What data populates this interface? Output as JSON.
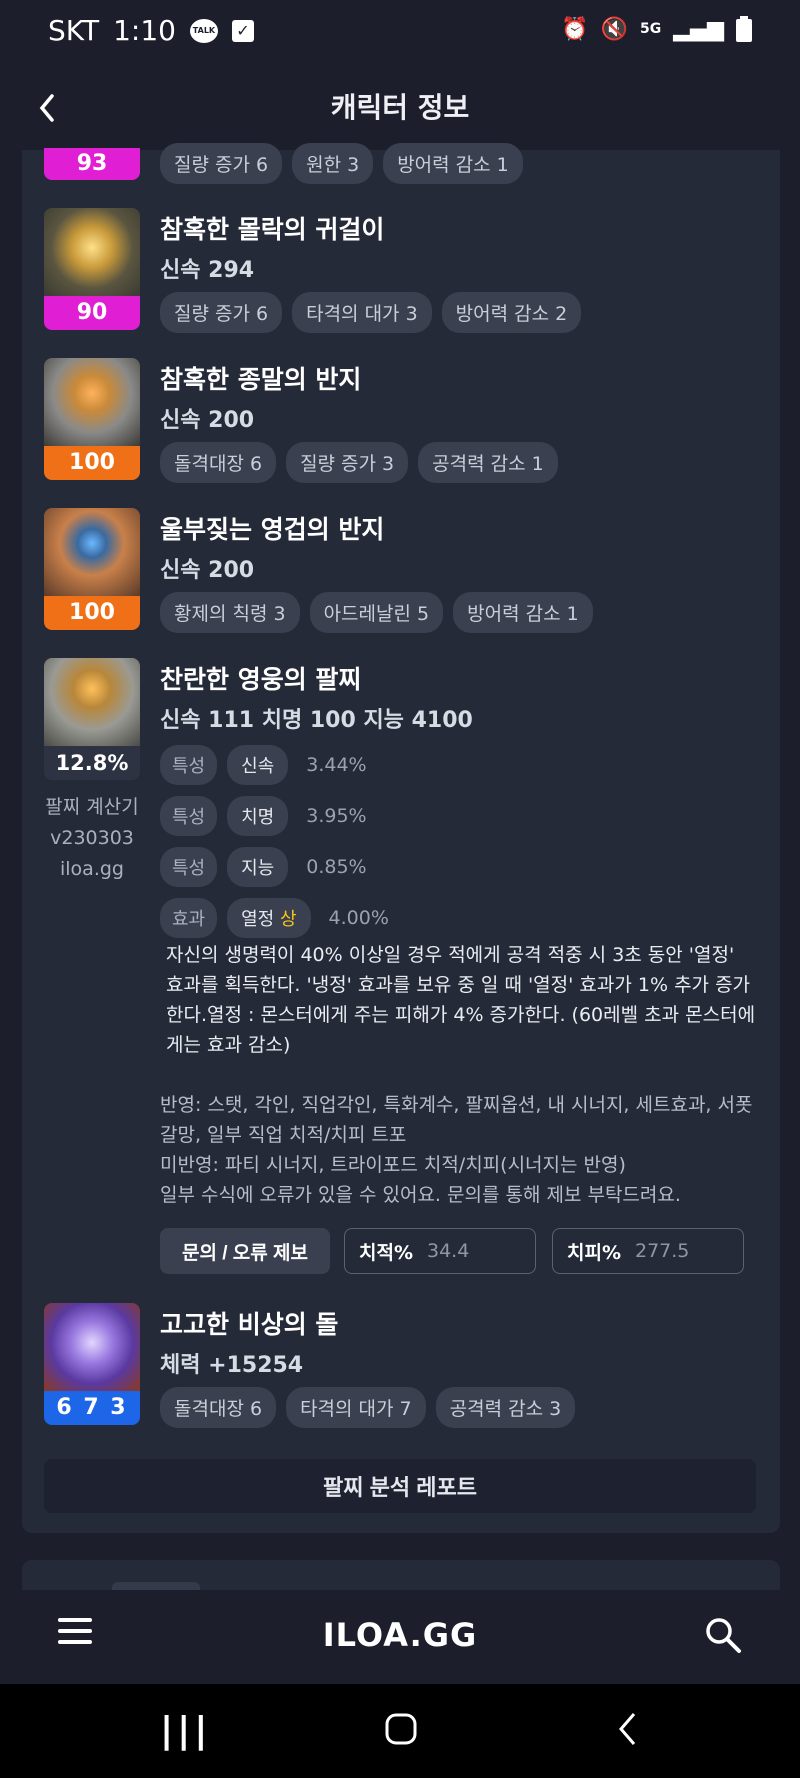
{
  "status": {
    "carrier": "SKT",
    "time": "1:10",
    "talk_badge": "TALK",
    "icons": [
      "alarm-icon",
      "mute-icon",
      "5g-icon",
      "signal-icon",
      "battery-icon"
    ]
  },
  "header": {
    "title": "캐릭터 정보"
  },
  "items": [
    {
      "level": "93",
      "level_color": "#e01fd4",
      "chips": [
        "질량 증가 6",
        "원한 3",
        "방어력 감소 1"
      ]
    },
    {
      "name": "참혹한 몰락의 귀걸이",
      "stat": "신속 294",
      "level": "90",
      "level_color": "#e01fd4",
      "chips": [
        "질량 증가 6",
        "타격의 대가 3",
        "방어력 감소 2"
      ]
    },
    {
      "name": "참혹한 종말의 반지",
      "stat": "신속 200",
      "level": "100",
      "level_color": "#f07018",
      "chips": [
        "돌격대장 6",
        "질량 증가 3",
        "공격력 감소 1"
      ]
    },
    {
      "name": "울부짖는 영겁의 반지",
      "stat": "신속 200",
      "level": "100",
      "level_color": "#f07018",
      "chips": [
        "황제의 칙령 3",
        "아드레날린 5",
        "방어력 감소 1"
      ]
    }
  ],
  "bracelet": {
    "name": "찬란한 영웅의 팔찌",
    "stat": "신속 111  치명 100  지능 4100",
    "percent": "12.8%",
    "calc_lines": [
      "팔찌 계산기",
      "v230303",
      "iloa.gg"
    ],
    "traits": [
      {
        "tag": "특성",
        "name": "신속",
        "pct": "3.44%"
      },
      {
        "tag": "특성",
        "name": "치명",
        "pct": "3.95%"
      },
      {
        "tag": "특성",
        "name": "지능",
        "pct": "0.85%"
      }
    ],
    "effect": {
      "tag": "효과",
      "name": "열정",
      "grade": "상",
      "pct": "4.00%"
    },
    "description": "자신의 생명력이 40% 이상일 경우 적에게 공격 적중 시 3초 동안 '열정' 효과를 획득한다. '냉정' 효과를 보유 중 일 때 '열정' 효과가 1% 추가 증가한다.열정 : 몬스터에게 주는 피해가 4% 증가한다. (60레벨 초과 몬스터에게는 효과 감소)",
    "notes": [
      "반영: 스탯, 각인, 직업각인, 특화계수, 팔찌옵션, 내 시너지, 세트효과, 서폿 갈망, 일부 직업 치적/치피 트포",
      "미반영: 파티 시너지, 트라이포드 치적/치피(시너지는 반영)",
      "일부 수식에 오류가 있을 수 있어요. 문의를 통해 제보 부탁드려요."
    ],
    "report_button": "문의 / 오류 제보",
    "crit_rate_label": "치적%",
    "crit_rate_value": "34.4",
    "crit_dmg_label": "치피%",
    "crit_dmg_value": "277.5"
  },
  "stone": {
    "name": "고고한 비상의 돌",
    "stat": "체력 +15254",
    "level": "6 7 3",
    "level_color": "#1e66e8",
    "chips": [
      "돌격대장 6",
      "타격의 대가 7",
      "공격력 감소 3"
    ]
  },
  "analysis_button": "팔찌 분석 레포트",
  "appbar": {
    "logo": "ILOA.GG"
  },
  "colors": {
    "background": "#1c1f2b",
    "card": "#252a38",
    "chip": "#3a4050",
    "grade_gold": "#f5c518"
  }
}
